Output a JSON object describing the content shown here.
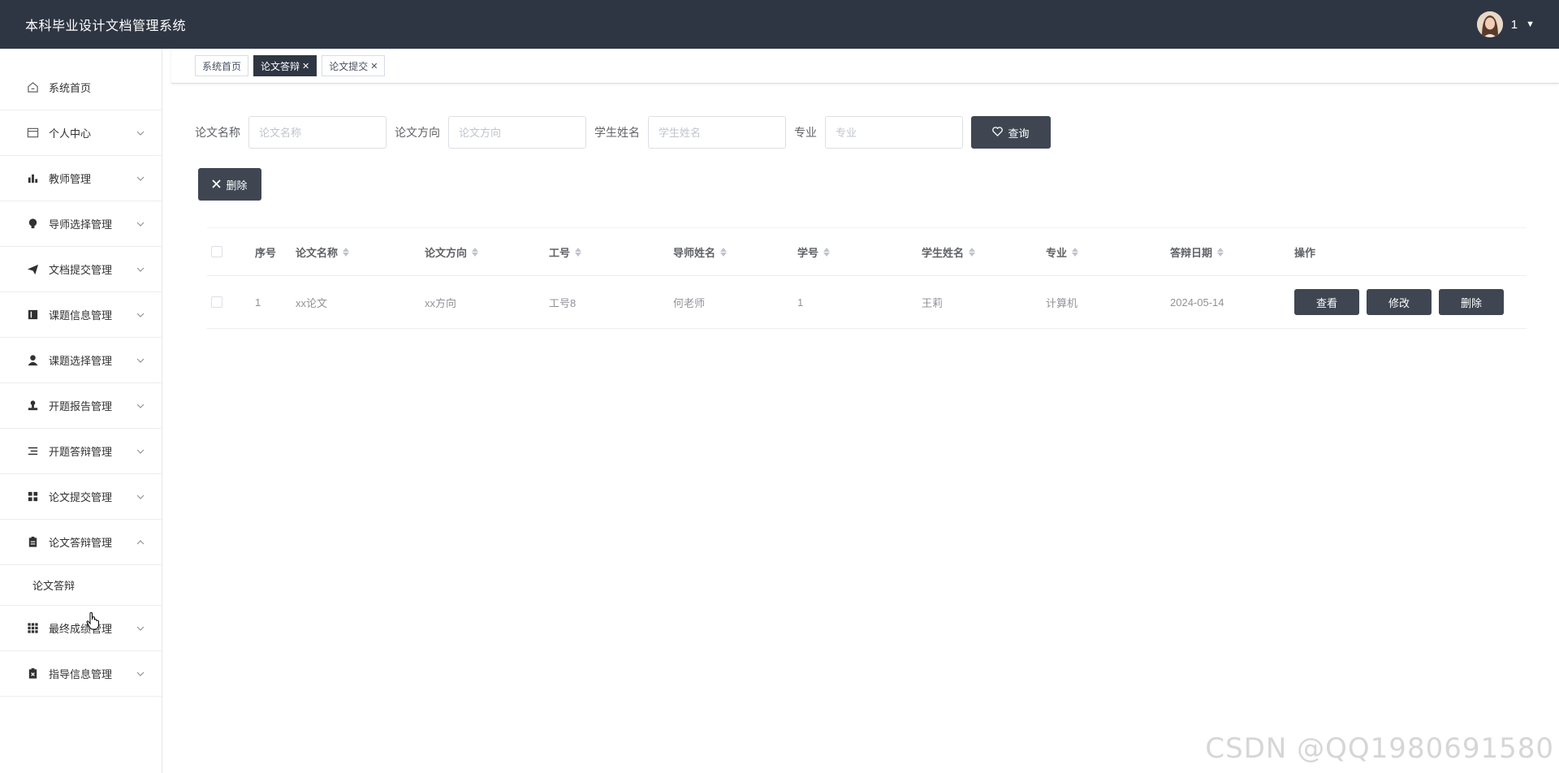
{
  "header": {
    "app_title": "本科毕业设计文档管理系统",
    "username": "1",
    "avatar_icon": "user-avatar"
  },
  "sidebar": {
    "items": [
      {
        "label": "系统首页",
        "icon": "home-icon",
        "arrow": false
      },
      {
        "label": "个人中心",
        "icon": "id-card-icon",
        "arrow": true
      },
      {
        "label": "教师管理",
        "icon": "bar-chart-icon",
        "arrow": true
      },
      {
        "label": "导师选择管理",
        "icon": "bulb-icon",
        "arrow": true
      },
      {
        "label": "文档提交管理",
        "icon": "send-icon",
        "arrow": true
      },
      {
        "label": "课题信息管理",
        "icon": "notebook-icon",
        "arrow": true
      },
      {
        "label": "课题选择管理",
        "icon": "user-icon",
        "arrow": true
      },
      {
        "label": "开题报告管理",
        "icon": "stamp-icon",
        "arrow": true
      },
      {
        "label": "开题答辩管理",
        "icon": "list-indent-icon",
        "arrow": true
      },
      {
        "label": "论文提交管理",
        "icon": "grid-icon",
        "arrow": true
      },
      {
        "label": "论文答辩管理",
        "icon": "clipboard-icon",
        "arrow": true,
        "expanded": true
      },
      {
        "label": "最终成绩管理",
        "icon": "apps-icon",
        "arrow": true
      },
      {
        "label": "指导信息管理",
        "icon": "clipboard-x-icon",
        "arrow": true
      }
    ],
    "submenu": {
      "label": "论文答辩"
    }
  },
  "tabs": [
    {
      "label": "系统首页",
      "closable": false,
      "active": false
    },
    {
      "label": "论文答辩",
      "closable": true,
      "active": true
    },
    {
      "label": "论文提交",
      "closable": true,
      "active": false
    }
  ],
  "search": {
    "fields": [
      {
        "label": "论文名称",
        "placeholder": "论文名称"
      },
      {
        "label": "论文方向",
        "placeholder": "论文方向"
      },
      {
        "label": "学生姓名",
        "placeholder": "学生姓名"
      },
      {
        "label": "专业",
        "placeholder": "专业"
      }
    ],
    "query_button": "查询",
    "delete_button": "删除"
  },
  "table": {
    "columns": [
      "序号",
      "论文名称",
      "论文方向",
      "工号",
      "导师姓名",
      "学号",
      "学生姓名",
      "专业",
      "答辩日期",
      "操作"
    ],
    "rows": [
      {
        "idx": "1",
        "name": "xx论文",
        "direction": "xx方向",
        "job_no": "工号8",
        "teacher": "何老师",
        "student_no": "1",
        "student_name": "王莉",
        "major": "计算机",
        "date": "2024-05-14"
      }
    ],
    "actions": [
      "查看",
      "修改",
      "删除"
    ]
  },
  "watermark": "CSDN @QQ1980691580",
  "colors": {
    "header_bg": "#2f3643",
    "button_bg": "#3f4652"
  }
}
